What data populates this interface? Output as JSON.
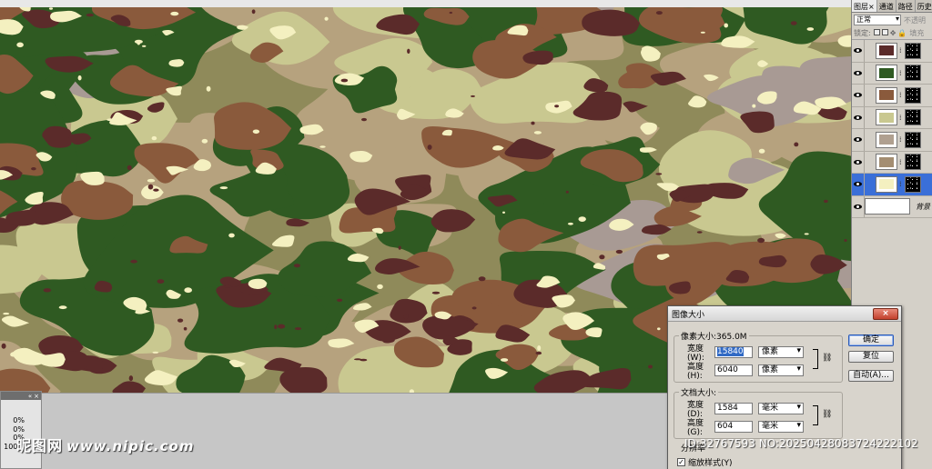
{
  "layers_panel": {
    "tabs": [
      "图层",
      "通道",
      "路径",
      "历史"
    ],
    "tab_close": "×",
    "blend_mode": "正常",
    "opacity_label": "不透明",
    "lock_label": "锁定:",
    "fill_label": "填充",
    "layers": [
      {
        "color": "#5b2b2a",
        "visible": true
      },
      {
        "color": "#2f5a22",
        "visible": true
      },
      {
        "color": "#8a5a3c",
        "visible": true
      },
      {
        "color": "#c9c890",
        "visible": true
      },
      {
        "color": "#b0a090",
        "visible": true
      },
      {
        "color": "#a48e72",
        "visible": true
      },
      {
        "color": "#f4f0c0",
        "visible": true,
        "selected": true
      }
    ],
    "background_label": "背景"
  },
  "mini_panel": {
    "values": [
      "0%",
      "0%",
      "0%",
      "100%"
    ]
  },
  "dialog": {
    "title": "图像大小",
    "close": "×",
    "pixel_size_label": "像素大小:365.0M",
    "width_label": "宽度(W):",
    "width_value": "15840",
    "width_unit": "像素",
    "height_label": "高度(H):",
    "height_value": "6040",
    "height_unit": "像素",
    "doc_size_label": "文档大小:",
    "doc_width_label": "宽度(D):",
    "doc_width_value": "1584",
    "doc_width_unit": "毫米",
    "doc_height_label": "高度(G):",
    "doc_height_value": "604",
    "doc_height_unit": "毫米",
    "resolution_label": "分辨率",
    "ok_label": "确定",
    "reset_label": "复位",
    "auto_label": "自动(A)...",
    "scale_styles_label": "缩放样式(Y)"
  },
  "watermarks": {
    "brand": "昵图网",
    "site": "www.nipic.com",
    "id_text": "ID:32767593 NO:20250428083724222102"
  },
  "colors": {
    "camo_base": "#8f8a5a",
    "camo_green": "#2f5a22",
    "camo_brown": "#8a5a3c",
    "camo_maroon": "#5b2b2a",
    "camo_tan": "#b6a27e",
    "camo_khaki": "#c9c890",
    "camo_cream": "#f4f0c0",
    "camo_mauve": "#a89a94"
  }
}
